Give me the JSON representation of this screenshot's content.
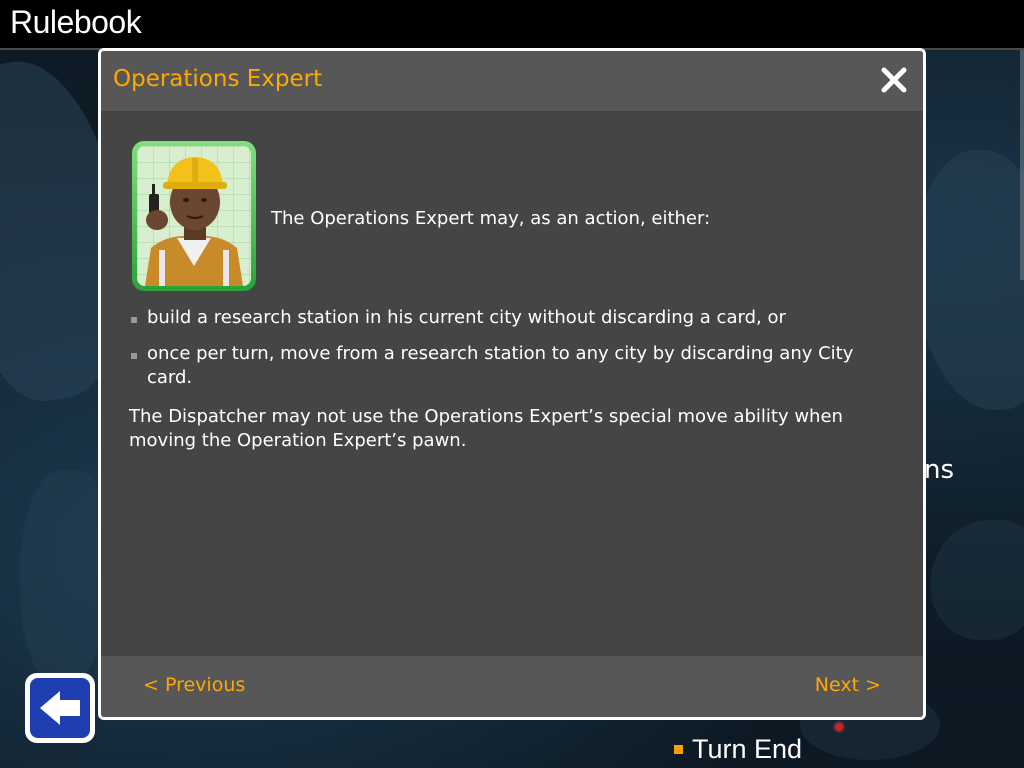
{
  "app": {
    "title": "Rulebook"
  },
  "background": {
    "partial_text": "ns",
    "turn_end_label": "Turn End"
  },
  "dialog": {
    "title": "Operations Expert",
    "intro": "The Operations Expert may, as an action, either:",
    "bullets": [
      "build a research station in his current city without discarding a card, or",
      "once per turn, move from a research station to any city by discarding any City card."
    ],
    "note": "The Dispatcher may not use the Operations Expert’s special move ability when moving the Operation Expert’s pawn.",
    "prev_label": "< Previous",
    "next_label": "Next >"
  },
  "icons": {
    "close": "close-icon",
    "back": "back-arrow-icon",
    "portrait": "operations-expert-portrait"
  },
  "colors": {
    "accent": "#ffa800",
    "dialog_bg": "#454545",
    "dialog_header": "#575757",
    "back_button": "#1f3fb0",
    "portrait_frame": "#2aa23a"
  }
}
